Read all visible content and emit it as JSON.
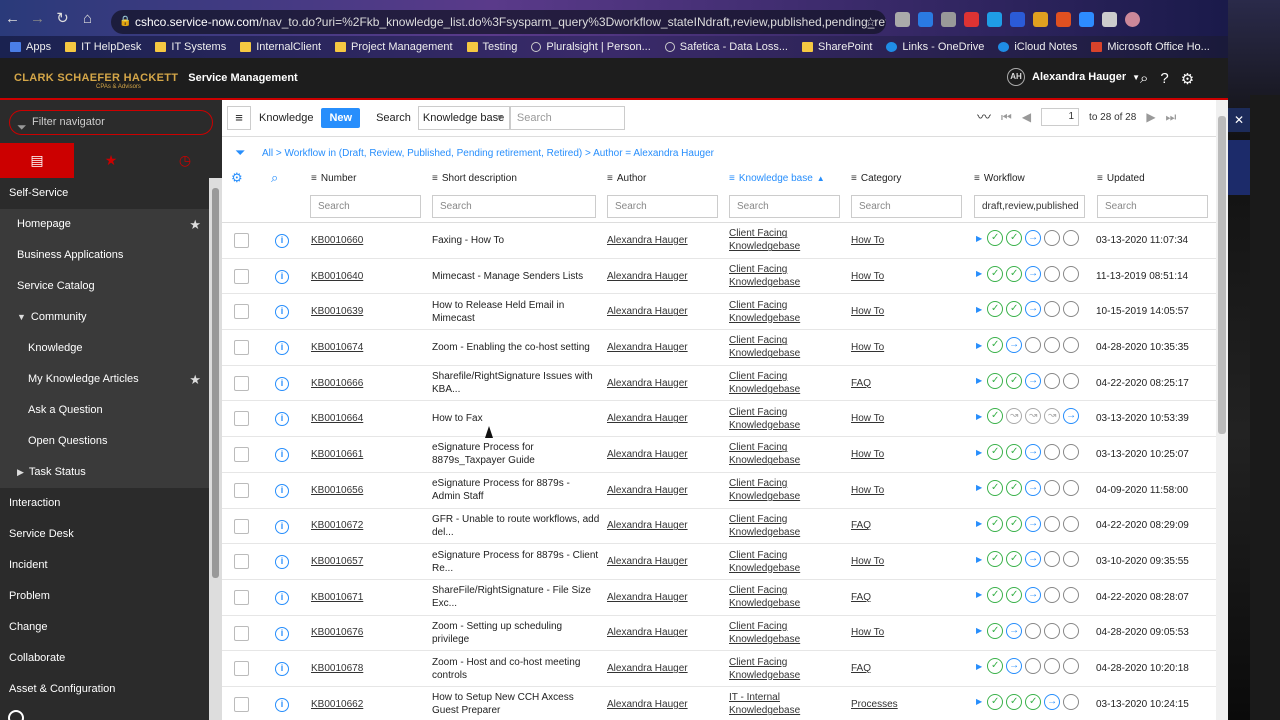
{
  "browser": {
    "url_host": "cshco.service-now.com",
    "url_path": "/nav_to.do?uri=%2Fkb_knowledge_list.do%3Fsysparm_query%3Dworkflow_stateINdraft,review,published,pending_retirement...",
    "bookmarks": [
      "Apps",
      "IT HelpDesk",
      "IT Systems",
      "InternalClient",
      "Project Management",
      "Testing",
      "Pluralsight | Person...",
      "Safetica - Data Loss...",
      "SharePoint",
      "Links - OneDrive",
      "iCloud Notes",
      "Microsoft Office Ho..."
    ]
  },
  "app": {
    "logo": "CLARK SCHAEFER HACKETT",
    "logo_sub": "CPAs & Advisors",
    "title": "Service Management",
    "user_initials": "AH",
    "user_name": "Alexandra Hauger"
  },
  "sidebar": {
    "filter_placeholder": "Filter navigator",
    "items": [
      {
        "label": "Self-Service",
        "level": 0
      },
      {
        "label": "Homepage",
        "level": 1,
        "star": true
      },
      {
        "label": "Business Applications",
        "level": 1
      },
      {
        "label": "Service Catalog",
        "level": 1
      },
      {
        "label": "Community",
        "level": 1,
        "caret": "down"
      },
      {
        "label": "Knowledge",
        "level": 2
      },
      {
        "label": "My Knowledge Articles",
        "level": 2,
        "star": true
      },
      {
        "label": "Ask a Question",
        "level": 2
      },
      {
        "label": "Open Questions",
        "level": 2
      },
      {
        "label": "Task Status",
        "level": 1,
        "caret": "right"
      },
      {
        "label": "Interaction",
        "level": 0
      },
      {
        "label": "Service Desk",
        "level": 0
      },
      {
        "label": "Incident",
        "level": 0
      },
      {
        "label": "Problem",
        "level": 0
      },
      {
        "label": "Change",
        "level": 0
      },
      {
        "label": "Collaborate",
        "level": 0
      },
      {
        "label": "Asset & Configuration",
        "level": 0
      }
    ]
  },
  "listbar": {
    "title": "Knowledge",
    "new_label": "New",
    "search_label": "Search",
    "search_field": "Knowledge base",
    "search_placeholder": "Search",
    "page": "1",
    "range": "to 28 of 28"
  },
  "breadcrumb": "All > Workflow in (Draft, Review, Published, Pending retirement, Retired) > Author = Alexandra Hauger",
  "columns": [
    "Number",
    "Short description",
    "Author",
    "Knowledge base",
    "Category",
    "Workflow",
    "Updated"
  ],
  "column_filters": [
    "Search",
    "Search",
    "Search",
    "Search",
    "Search",
    "draft,review,published",
    "Search"
  ],
  "rows": [
    {
      "number": "KB0010660",
      "desc": "Faxing - How To",
      "author": "Alexandra Hauger",
      "kb": "Client Facing Knowledgebase",
      "category": "How To",
      "wf": [
        "done",
        "done",
        "cur",
        "empty",
        "empty"
      ],
      "updated": "03-13-2020 11:07:34"
    },
    {
      "number": "KB0010640",
      "desc": "Mimecast - Manage Senders Lists",
      "author": "Alexandra Hauger",
      "kb": "Client Facing Knowledgebase",
      "category": "How To",
      "wf": [
        "done",
        "done",
        "cur",
        "empty",
        "empty"
      ],
      "updated": "11-13-2019 08:51:14"
    },
    {
      "number": "KB0010639",
      "desc": "How to Release Held Email in Mimecast",
      "author": "Alexandra Hauger",
      "kb": "Client Facing Knowledgebase",
      "category": "How To",
      "wf": [
        "done",
        "done",
        "cur",
        "empty",
        "empty"
      ],
      "updated": "10-15-2019 14:05:57"
    },
    {
      "number": "KB0010674",
      "desc": "Zoom - Enabling the co-host setting",
      "author": "Alexandra Hauger",
      "kb": "Client Facing Knowledgebase",
      "category": "How To",
      "wf": [
        "done",
        "cur",
        "empty",
        "empty",
        "empty"
      ],
      "updated": "04-28-2020 10:35:35"
    },
    {
      "number": "KB0010666",
      "desc": "Sharefile/RightSignature Issues with KBA...",
      "author": "Alexandra Hauger",
      "kb": "Client Facing Knowledgebase",
      "category": "FAQ",
      "wf": [
        "done",
        "done",
        "cur",
        "empty",
        "empty"
      ],
      "updated": "04-22-2020 08:25:17"
    },
    {
      "number": "KB0010664",
      "desc": "How to Fax",
      "author": "Alexandra Hauger",
      "kb": "Client Facing Knowledgebase",
      "category": "How To",
      "wf": [
        "done",
        "skip",
        "skip",
        "skip",
        "cur"
      ],
      "updated": "03-13-2020 10:53:39"
    },
    {
      "number": "KB0010661",
      "desc": "eSignature Process for 8879s_Taxpayer Guide",
      "author": "Alexandra Hauger",
      "kb": "Client Facing Knowledgebase",
      "category": "How To",
      "wf": [
        "done",
        "done",
        "cur",
        "empty",
        "empty"
      ],
      "updated": "03-13-2020 10:25:07"
    },
    {
      "number": "KB0010656",
      "desc": "eSignature Process for 8879s - Admin Staff",
      "author": "Alexandra Hauger",
      "kb": "Client Facing Knowledgebase",
      "category": "How To",
      "wf": [
        "done",
        "done",
        "cur",
        "empty",
        "empty"
      ],
      "updated": "04-09-2020 11:58:00"
    },
    {
      "number": "KB0010672",
      "desc": "GFR - Unable to route workflows, add del...",
      "author": "Alexandra Hauger",
      "kb": "Client Facing Knowledgebase",
      "category": "FAQ",
      "wf": [
        "done",
        "done",
        "cur",
        "empty",
        "empty"
      ],
      "updated": "04-22-2020 08:29:09"
    },
    {
      "number": "KB0010657",
      "desc": "eSignature Process for 8879s - Client Re...",
      "author": "Alexandra Hauger",
      "kb": "Client Facing Knowledgebase",
      "category": "How To",
      "wf": [
        "done",
        "done",
        "cur",
        "empty",
        "empty"
      ],
      "updated": "03-10-2020 09:35:55"
    },
    {
      "number": "KB0010671",
      "desc": "ShareFile/RightSignature - File Size Exc...",
      "author": "Alexandra Hauger",
      "kb": "Client Facing Knowledgebase",
      "category": "FAQ",
      "wf": [
        "done",
        "done",
        "cur",
        "empty",
        "empty"
      ],
      "updated": "04-22-2020 08:28:07"
    },
    {
      "number": "KB0010676",
      "desc": "Zoom - Setting up scheduling privilege",
      "author": "Alexandra Hauger",
      "kb": "Client Facing Knowledgebase",
      "category": "How To",
      "wf": [
        "done",
        "cur",
        "empty",
        "empty",
        "empty"
      ],
      "updated": "04-28-2020 09:05:53"
    },
    {
      "number": "KB0010678",
      "desc": "Zoom - Host and co-host meeting controls",
      "author": "Alexandra Hauger",
      "kb": "Client Facing Knowledgebase",
      "category": "FAQ",
      "wf": [
        "done",
        "cur",
        "empty",
        "empty",
        "empty"
      ],
      "updated": "04-28-2020 10:20:18"
    },
    {
      "number": "KB0010662",
      "desc": "How to Setup New CCH Axcess Guest Preparer",
      "author": "Alexandra Hauger",
      "kb": "IT - Internal Knowledgebase",
      "category": "Processes",
      "wf": [
        "done",
        "done",
        "done",
        "cur",
        "empty"
      ],
      "updated": "03-13-2020 10:24:15"
    }
  ]
}
